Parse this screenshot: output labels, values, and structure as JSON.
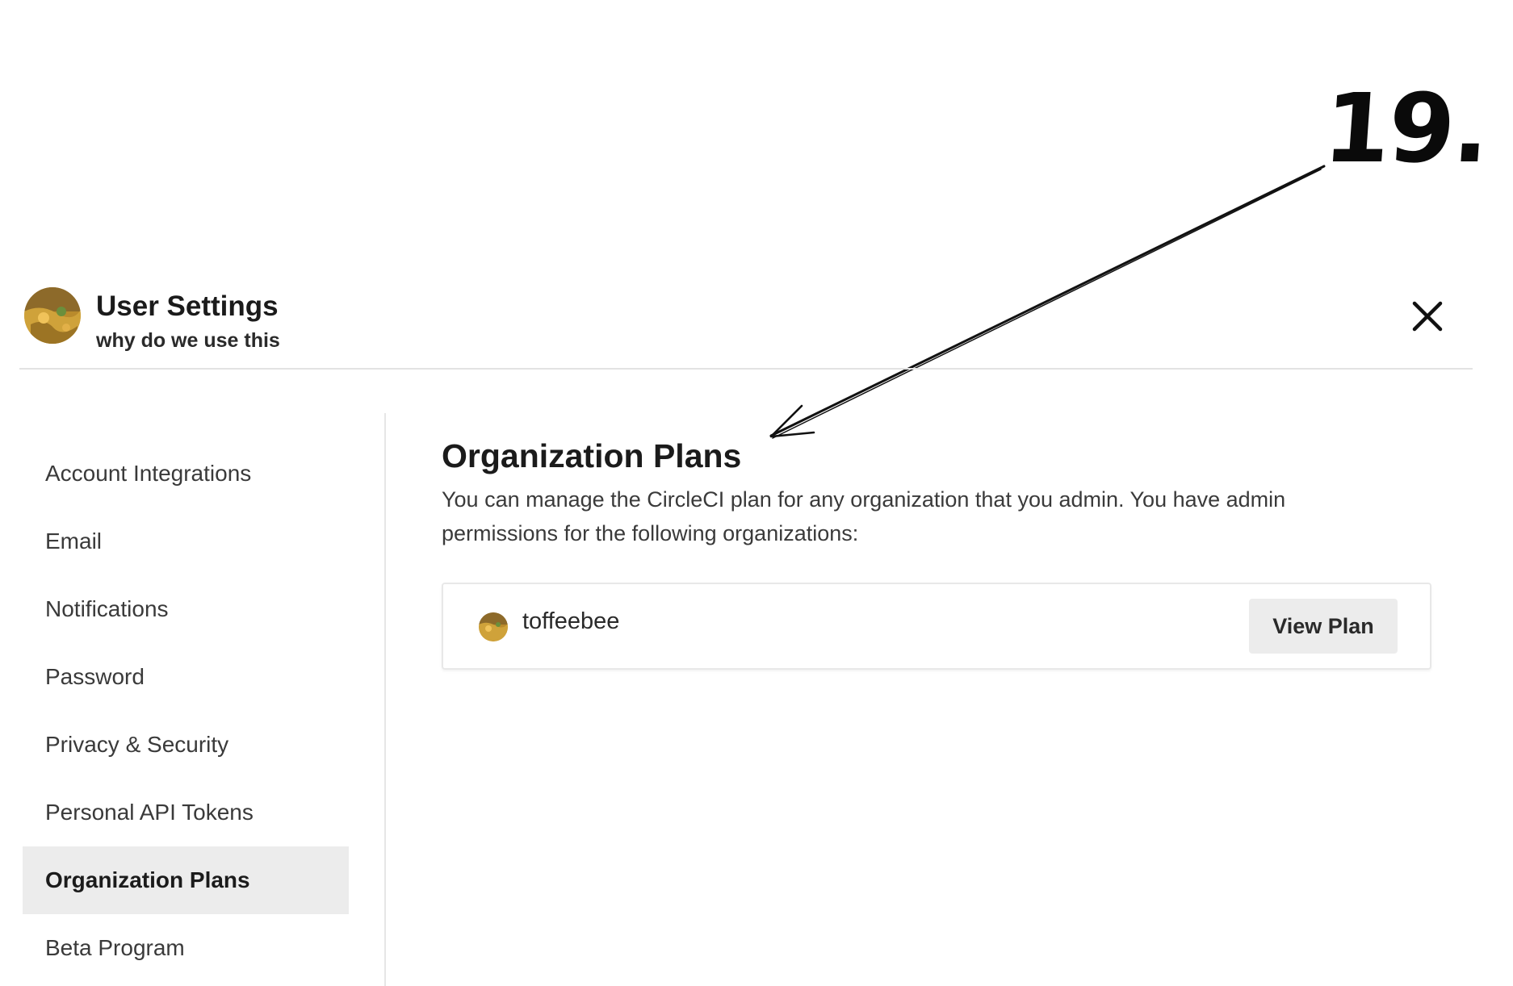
{
  "annotation": {
    "number": "19."
  },
  "header": {
    "title": "User Settings",
    "subtitle": "why do we use this",
    "avatar_icon": "user-avatar",
    "close_icon": "close-icon"
  },
  "sidebar": {
    "items": [
      {
        "label": "Account Integrations",
        "active": false
      },
      {
        "label": "Email",
        "active": false
      },
      {
        "label": "Notifications",
        "active": false
      },
      {
        "label": "Password",
        "active": false
      },
      {
        "label": "Privacy & Security",
        "active": false
      },
      {
        "label": "Personal API Tokens",
        "active": false
      },
      {
        "label": "Organization Plans",
        "active": true
      },
      {
        "label": "Beta Program",
        "active": false
      }
    ]
  },
  "main": {
    "title": "Organization Plans",
    "description": "You can manage the CircleCI plan for any organization that you admin. You have admin permissions for the following organizations:",
    "organizations": [
      {
        "name": "toffeebee",
        "button_label": "View Plan"
      }
    ]
  },
  "colors": {
    "active_bg": "#ececec",
    "divider": "#e3e3e3",
    "text_primary": "#1b1b1b",
    "text_secondary": "#3a3a3a"
  }
}
